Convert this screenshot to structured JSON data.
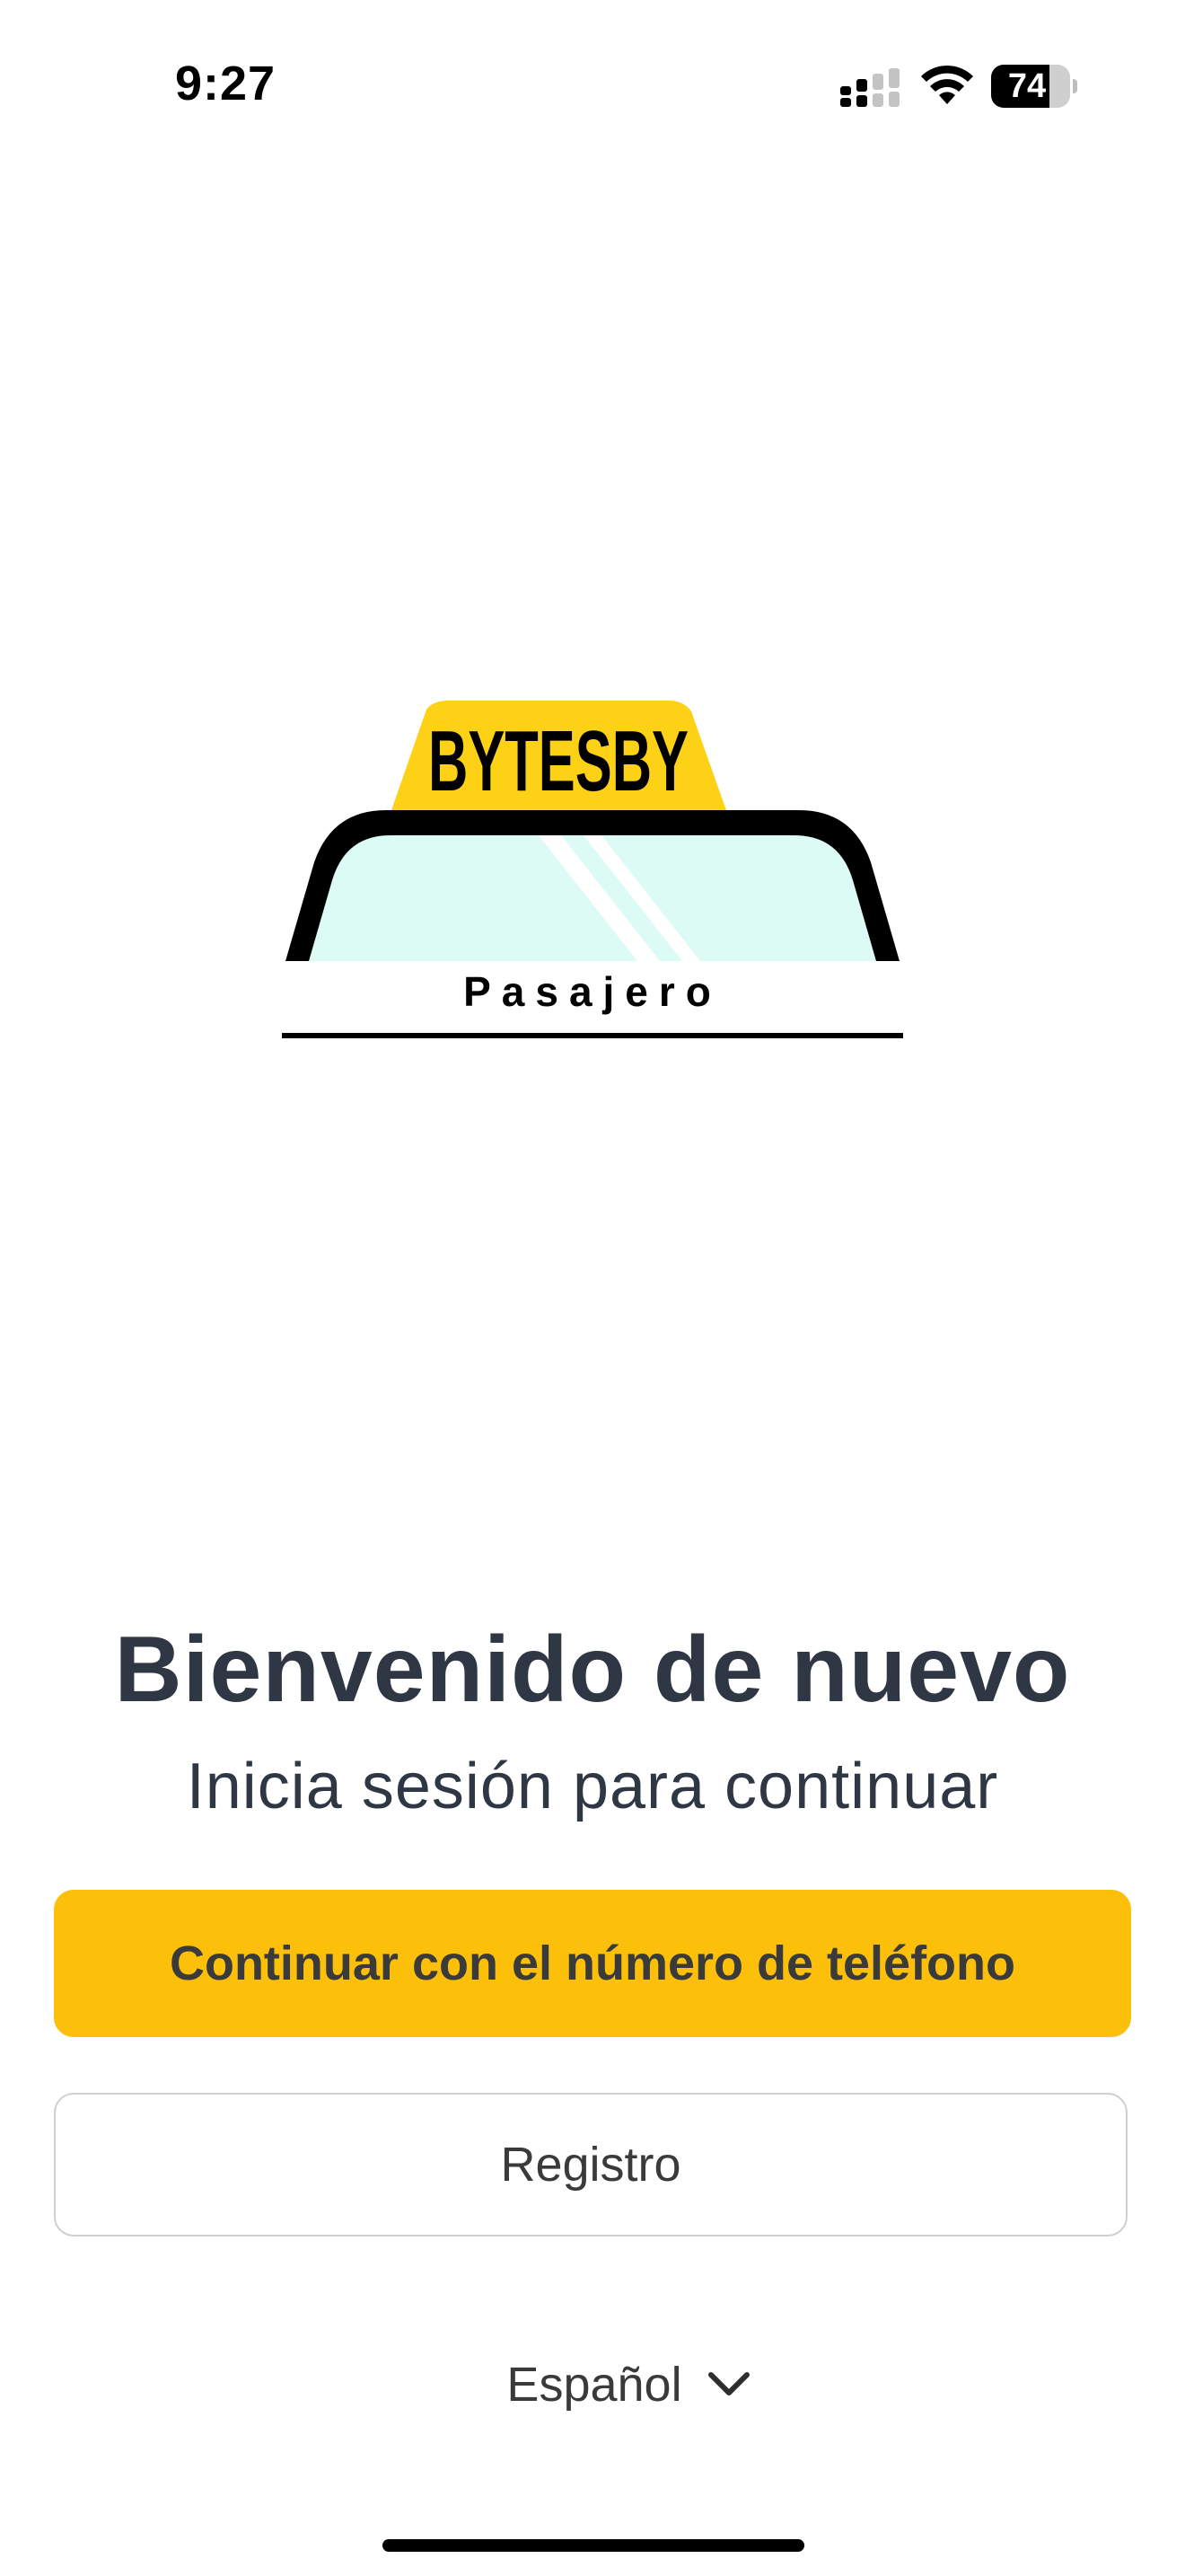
{
  "status_bar": {
    "time": "9:27",
    "battery_level": "74",
    "battery_fraction": 0.74
  },
  "logo": {
    "brand": "BYTESBY",
    "subtitle": "Pasajero"
  },
  "welcome": {
    "title": "Bienvenido de nuevo",
    "subtitle": "Inicia sesión para continuar"
  },
  "actions": {
    "phone_label": "Continuar con el número de teléfono",
    "register_label": "Registro"
  },
  "language": {
    "selected": "Español"
  },
  "colors": {
    "accent": "#fcc00a",
    "taxi_sign": "#fcd116",
    "windshield": "#dcfbf5",
    "text_dark": "#2f3745"
  },
  "icons": {
    "signal": "cellular-signal-icon",
    "wifi": "wifi-icon",
    "battery": "battery-icon",
    "chevron": "chevron-down-icon"
  }
}
